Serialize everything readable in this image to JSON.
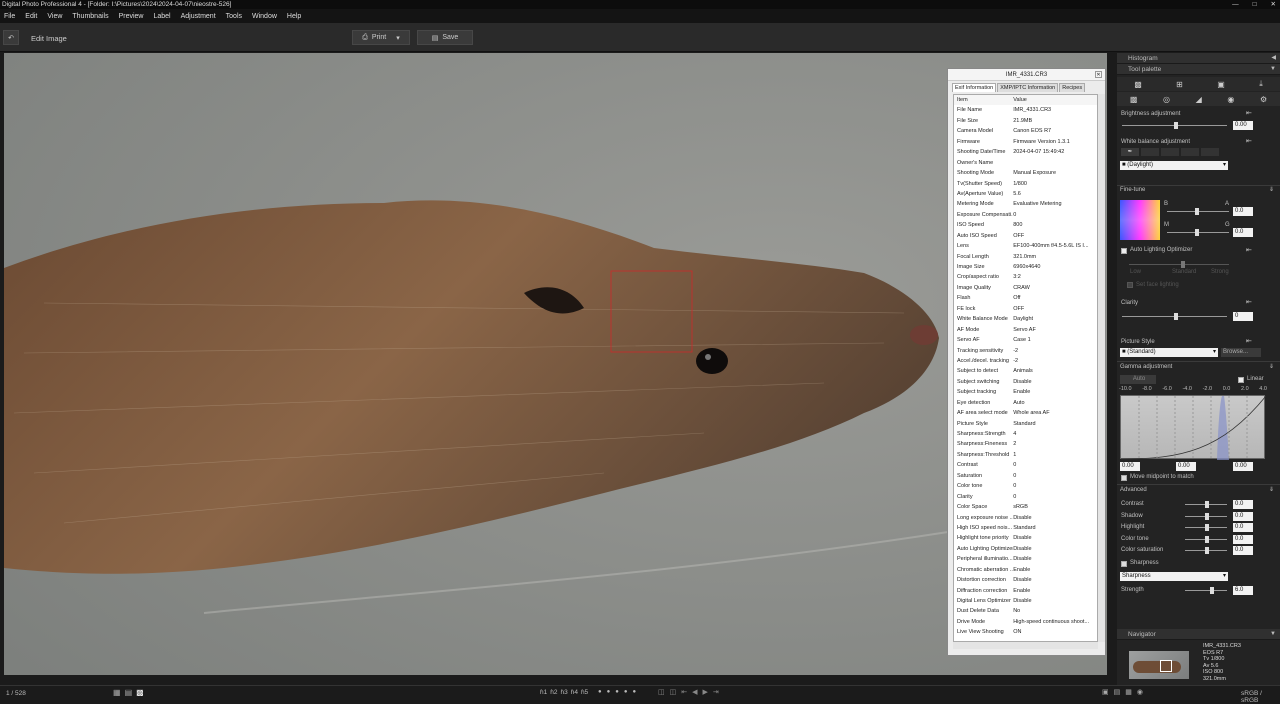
{
  "window": {
    "title": "Digital Photo Professional 4 - [Folder: I:\\Pictures\\2024\\2024-04-07\\nieostre-526]"
  },
  "menu": [
    "File",
    "Edit",
    "View",
    "Thumbnails",
    "Preview",
    "Label",
    "Adjustment",
    "Tools",
    "Window",
    "Help"
  ],
  "toolbar": {
    "edit_image": "Edit Image",
    "print": "Print",
    "save": "Save"
  },
  "exif": {
    "title": "IMR_4331.CR3",
    "tabs": [
      "Exif Information",
      "XMP/IPTC Information",
      "Recipes"
    ],
    "col_item": "Item",
    "col_value": "Value",
    "rows": [
      [
        "File Name",
        "IMR_4331.CR3"
      ],
      [
        "File Size",
        "21.9MB"
      ],
      [
        "Camera Model",
        "Canon EOS R7"
      ],
      [
        "Firmware",
        "Firmware Version 1.3.1"
      ],
      [
        "Shooting Date/Time",
        "2024-04-07 15:49:42"
      ],
      [
        "Owner's Name",
        ""
      ],
      [
        "Shooting Mode",
        "Manual Exposure"
      ],
      [
        "Tv(Shutter Speed)",
        "1/800"
      ],
      [
        "Av(Aperture Value)",
        "5.6"
      ],
      [
        "Metering Mode",
        "Evaluative Metering"
      ],
      [
        "Exposure Compensati...",
        "0"
      ],
      [
        "ISO Speed",
        "800"
      ],
      [
        "Auto ISO Speed",
        "OFF"
      ],
      [
        "Lens",
        "EF100-400mm f/4.5-5.6L IS I..."
      ],
      [
        "Focal Length",
        "321.0mm"
      ],
      [
        "Image Size",
        "6960x4640"
      ],
      [
        "Crop/aspect ratio",
        "3:2"
      ],
      [
        "Image Quality",
        "CRAW"
      ],
      [
        "Flash",
        "Off"
      ],
      [
        "FE lock",
        "OFF"
      ],
      [
        "White Balance Mode",
        "Daylight"
      ],
      [
        "AF Mode",
        "Servo AF"
      ],
      [
        "Servo AF",
        "Case 1"
      ],
      [
        "Tracking sensitivity",
        "-2"
      ],
      [
        "Accel./decel. tracking",
        "-2"
      ],
      [
        "Subject to detect",
        "Animals"
      ],
      [
        "Subject switching",
        "Disable"
      ],
      [
        "Subject tracking",
        "Enable"
      ],
      [
        "Eye detection",
        "Auto"
      ],
      [
        "AF area select mode",
        "Whole area AF"
      ],
      [
        "Picture Style",
        "Standard"
      ],
      [
        "Sharpness:Strength",
        "4"
      ],
      [
        "Sharpness:Fineness",
        "2"
      ],
      [
        "Sharpness:Threshold",
        "1"
      ],
      [
        "Contrast",
        "0"
      ],
      [
        "Saturation",
        "0"
      ],
      [
        "Color tone",
        "0"
      ],
      [
        "Clarity",
        "0"
      ],
      [
        "Color Space",
        "sRGB"
      ],
      [
        "Long exposure noise ...",
        "Disable"
      ],
      [
        "High ISO speed nois...",
        "Standard"
      ],
      [
        "Highlight tone priority",
        "Disable"
      ],
      [
        "Auto Lighting Optimizer",
        "Disable"
      ],
      [
        "Peripheral illuminatio...",
        "Disable"
      ],
      [
        "Chromatic aberration ...",
        "Enable"
      ],
      [
        "Distortion correction",
        "Disable"
      ],
      [
        "Diffraction correction",
        "Enable"
      ],
      [
        "Digital Lens Optimizer",
        "Disable"
      ],
      [
        "Dust Delete Data",
        "No"
      ],
      [
        "Drive Mode",
        "High-speed continuous shoot..."
      ],
      [
        "Live View Shooting",
        "ON"
      ]
    ]
  },
  "panel": {
    "histogram": "Histogram",
    "tool_palette": "Tool palette",
    "brightness": "Brightness adjustment",
    "brightness_val": "0.00",
    "white_balance": "White balance adjustment",
    "wb_mode": "(Daylight)",
    "fine_tune": "Fine-tune",
    "ft_b": "B",
    "ft_a": "A",
    "ft_m": "M",
    "ft_g": "G",
    "ft_a_val": "0.0",
    "ft_g_val": "0.0",
    "alo": "Auto Lighting Optimizer",
    "alo_low": "Low",
    "alo_std": "Standard",
    "alo_strong": "Strong",
    "alo_faces": "Set face lighting",
    "clarity": "Clarity",
    "clarity_val": "0",
    "picture_style": "Picture Style",
    "ps_val": "(Standard)",
    "browse": "Browse...",
    "gamma": "Gamma adjustment",
    "auto": "Auto",
    "linear": "Linear",
    "gamma_ticks": [
      "-10.0",
      "-8.0",
      "-6.0",
      "-4.0",
      "-2.0",
      "0.0",
      "2.0",
      "4.0"
    ],
    "gamma_vals": [
      "0.00",
      "0.00",
      "0.00"
    ],
    "move_midpoint": "Move midpoint to match",
    "advanced": "Advanced",
    "adv": [
      [
        "Contrast",
        "0.0"
      ],
      [
        "Shadow",
        "0.0"
      ],
      [
        "Highlight",
        "0.0"
      ],
      [
        "Color tone",
        "0.0"
      ],
      [
        "Color saturation",
        "0.0"
      ]
    ],
    "sharpness": "Sharpness",
    "sharpness_sel": "Sharpness",
    "strength": "Strength",
    "strength_val": "6.0",
    "navigator": "Navigator",
    "nav_info": [
      "IMR_4331.CR3",
      "EOS R7",
      "Tv 1/800",
      "Av 5.6",
      "ISO 800",
      "321.0mm"
    ]
  },
  "status": {
    "count": "1 / 528",
    "color": "sRGB / sRGB",
    "ratings": [
      "ɦ1",
      "ɦ2",
      "ɦ3",
      "ɦ4",
      "ɦ5"
    ]
  }
}
